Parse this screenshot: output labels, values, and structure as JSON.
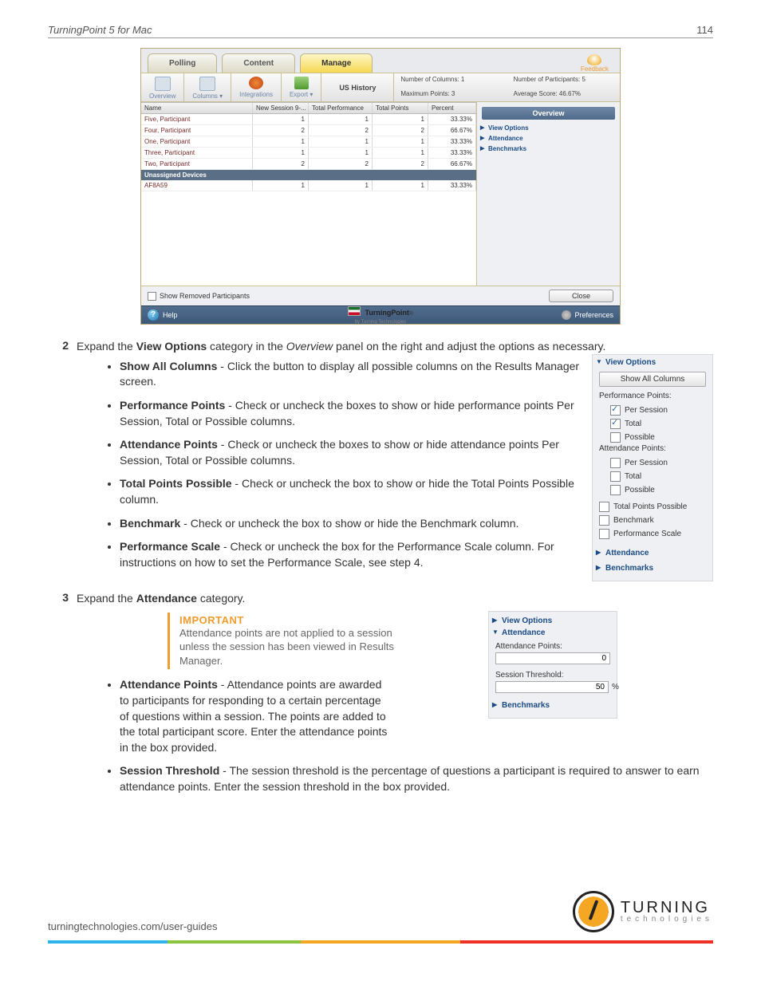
{
  "header": {
    "title": "TurningPoint 5 for Mac",
    "page": "114"
  },
  "screenshot": {
    "tabs": {
      "polling": "Polling",
      "content": "Content",
      "manage": "Manage"
    },
    "feedback": "Feedback",
    "tools": {
      "overview": "Overview",
      "columns": "Columns  ▾",
      "integrations": "Integrations",
      "export": "Export  ▾"
    },
    "session_title": "US History",
    "stats": {
      "cols_lbl": "Number of Columns: 1",
      "parts_lbl": "Number of Participants: 5",
      "max_lbl": "Maximum Points: 3",
      "avg_lbl": "Average Score: 46.67%"
    },
    "grid_headers": [
      "Name",
      "New Session 9-...",
      "Total Performance",
      "Total Points",
      "Percent"
    ],
    "rows": [
      {
        "name": "Five, Participant",
        "c1": "1",
        "c2": "1",
        "c3": "1",
        "c4": "33.33%"
      },
      {
        "name": "Four, Participant",
        "c1": "2",
        "c2": "2",
        "c3": "2",
        "c4": "66.67%"
      },
      {
        "name": "One, Participant",
        "c1": "1",
        "c2": "1",
        "c3": "1",
        "c4": "33.33%"
      },
      {
        "name": "Three, Participant",
        "c1": "1",
        "c2": "1",
        "c3": "1",
        "c4": "33.33%"
      },
      {
        "name": "Two, Participant",
        "c1": "2",
        "c2": "2",
        "c3": "2",
        "c4": "66.67%"
      }
    ],
    "unassigned_label": "Unassigned Devices",
    "unassigned_row": {
      "name": "AF8A59",
      "c1": "1",
      "c2": "1",
      "c3": "1",
      "c4": "33.33%"
    },
    "side": {
      "overview": "Overview",
      "view_options": "View Options",
      "attendance": "Attendance",
      "benchmarks": "Benchmarks"
    },
    "removed_label": "Show Removed Participants",
    "close": "Close",
    "help": "Help",
    "preferences": "Preferences",
    "brand": "TurningPoint",
    "brand_sub": "by Turning Technologies"
  },
  "step2": {
    "num": "2",
    "text_a": "Expand the ",
    "text_b": "View Options",
    "text_c": " category in the ",
    "text_d": "Overview",
    "text_e": " panel on the right and adjust the options as necessary."
  },
  "list2": {
    "i1b": "Show All Columns",
    "i1t": " - Click the button to display all possible columns on the Results Manager screen.",
    "i2b": "Performance Points",
    "i2t": " - Check or uncheck the boxes to show or hide performance points Per Session, Total or Possible columns.",
    "i3b": "Attendance Points",
    "i3t": " - Check or uncheck the boxes to show or hide attendance points Per Session, Total or Possible columns.",
    "i4b": "Total Points Possible",
    "i4t": " - Check or uncheck the box to show or hide the Total Points Possible column.",
    "i5b": "Benchmark",
    "i5t": " - Check or uncheck the box to show or hide the Benchmark column.",
    "i6b": "Performance Scale",
    "i6t": " - Check or uncheck the box for the Performance Scale column. For instructions on how to set the Performance Scale, see step 4."
  },
  "panel_vo": {
    "view_options": "View Options",
    "show_all": "Show All Columns",
    "perf_lbl": "Performance Points:",
    "per_session": "Per Session",
    "total": "Total",
    "possible": "Possible",
    "att_lbl": "Attendance Points:",
    "tpp": "Total Points Possible",
    "benchmark": "Benchmark",
    "perf_scale": "Performance Scale",
    "attendance": "Attendance",
    "benchmarks": "Benchmarks"
  },
  "step3": {
    "num": "3",
    "text_a": "Expand the ",
    "text_b": "Attendance",
    "text_c": " category."
  },
  "important": {
    "title": "IMPORTANT",
    "text": "Attendance points are not applied to a session unless the session has been viewed in Results Manager."
  },
  "att_panel": {
    "view_options": "View Options",
    "attendance": "Attendance",
    "att_pts_lbl": "Attendance Points:",
    "att_pts_val": "0",
    "sess_lbl": "Session Threshold:",
    "sess_val": "50",
    "pct": "%",
    "benchmarks": "Benchmarks"
  },
  "list3": {
    "i1b": "Attendance Points",
    "i1t": " - Attendance points are awarded to participants for responding to a certain percentage of questions within a session. The points are added to the total participant score. Enter the attendance points in the box provided.",
    "i2b": "Session Threshold",
    "i2t": " - The session threshold is the percentage of questions a participant is required to answer to earn attendance points. Enter the session threshold in the box provided."
  },
  "footer": {
    "url": "turningtechnologies.com/user-guides",
    "brand_a": "TURNING",
    "brand_b": "technologies"
  }
}
